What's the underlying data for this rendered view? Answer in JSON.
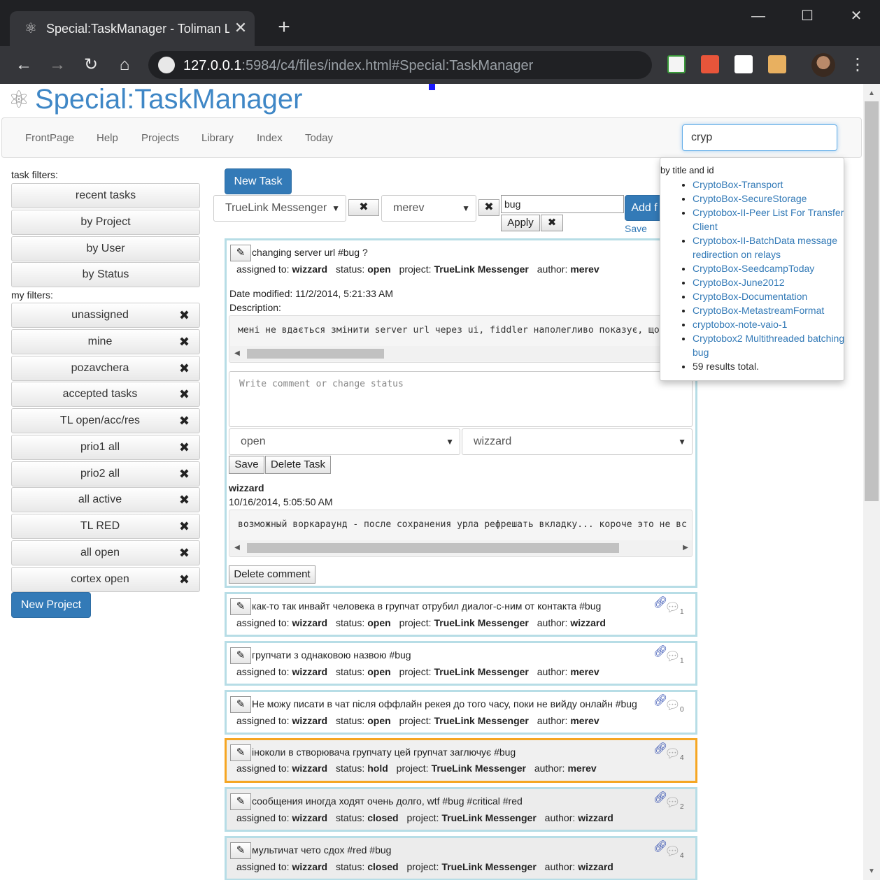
{
  "browser": {
    "tab_title": "Special:TaskManager - Toliman LL",
    "url_host": "127.0.0.1",
    "url_rest": ":5984/c4/files/index.html#Special:TaskManager",
    "tab_close": "✕",
    "new_tab": "+",
    "minimize": "—",
    "maximize": "☐",
    "close": "✕",
    "back": "←",
    "forward": "→",
    "reload": "↻",
    "home": "⌂",
    "menu": "⋮"
  },
  "page": {
    "title": "Special:TaskManager"
  },
  "nav": {
    "items": [
      "FrontPage",
      "Help",
      "Projects",
      "Library",
      "Index",
      "Today"
    ],
    "search_value": "cryp"
  },
  "search_dropdown": {
    "heading": "by title and id",
    "results": [
      "CryptoBox-Transport",
      "CryptoBox-SecureStorage",
      "Cryptobox-II-Peer List For Transfer Client",
      "Cryptobox-II-BatchData message redirection on relays",
      "CryptoBox-SeedcampToday",
      "CryptoBox-June2012",
      "CryptoBox-Documentation",
      "CryptoBox-MetastreamFormat",
      "cryptobox-note-vaio-1",
      "Cryptobox2 Multithreaded batching bug"
    ],
    "total": "59 results total."
  },
  "sidebar": {
    "task_filters_label": "task filters:",
    "task_filters": [
      "recent tasks",
      "by Project",
      "by User",
      "by Status"
    ],
    "my_filters_label": "my filters:",
    "my_filters": [
      "unassigned",
      "mine",
      "pozavchera",
      "accepted tasks",
      "TL open/acc/res",
      "prio1 all",
      "prio2 all",
      "all active",
      "TL RED",
      "all open",
      "cortex open"
    ],
    "remove_glyph": "✖",
    "new_project": "New Project"
  },
  "toolbar": {
    "new_task": "New Task",
    "project_select": "TrueLink Messenger",
    "user_select": "merev",
    "clear_glyph": "✖",
    "filter_text": "bug",
    "apply": "Apply",
    "add_btn": "Add f",
    "save_link": "Save"
  },
  "expanded_task": {
    "title": "changing server url #bug ?",
    "assigned_label": "assigned to:",
    "assigned": "wizzard",
    "status_label": "status:",
    "status": "open",
    "project_label": "project:",
    "project": "TrueLink Messenger",
    "author_label": "author:",
    "author": "merev",
    "date_modified": "Date modified: 11/2/2014, 5:21:33 AM",
    "description_label": "Description:",
    "description": "мені не вдається змінити server url через ui, fiddler наполегливо показує, що",
    "comment_placeholder": "Write comment or change status",
    "status_select": "open",
    "assignee_select": "wizzard",
    "save": "Save",
    "delete_task": "Delete Task",
    "comment_author": "wizzard",
    "comment_date": "10/16/2014, 5:05:50 AM",
    "comment_text": "возможный воркараунд - после сохранения урла рефрешать вкладку... короче это не вс",
    "delete_comment": "Delete comment"
  },
  "tasks": [
    {
      "title": "как-то так инвайт человека в групчат отрубил диалог-с-ним от контакта #bug",
      "assigned": "wizzard",
      "status": "open",
      "project": "TrueLink Messenger",
      "author": "wizzard",
      "comments": "1"
    },
    {
      "title": "групчати з однаковою назвою #bug",
      "assigned": "wizzard",
      "status": "open",
      "project": "TrueLink Messenger",
      "author": "merev",
      "comments": "1"
    },
    {
      "title": "Не можу писати в чат після оффлайн рекея до того часу, поки не вийду онлайн #bug",
      "assigned": "wizzard",
      "status": "open",
      "project": "TrueLink Messenger",
      "author": "merev",
      "comments": "0"
    },
    {
      "title": "іноколи в створювача групчату цей групчат заглючує #bug",
      "assigned": "wizzard",
      "status": "hold",
      "project": "TrueLink Messenger",
      "author": "merev",
      "comments": "4"
    },
    {
      "title": "сообщения иногда ходят очень долго, wtf #bug #critical #red",
      "assigned": "wizzard",
      "status": "closed",
      "project": "TrueLink Messenger",
      "author": "wizzard",
      "comments": "2"
    },
    {
      "title": "мультичат чето сдох #red #bug",
      "assigned": "wizzard",
      "status": "closed",
      "project": "TrueLink Messenger",
      "author": "wizzard",
      "comments": "4"
    }
  ],
  "colors": {
    "accent": "#337ab7",
    "title_blue": "#3f87c6",
    "card_border": "#b7dde6",
    "hold_border": "#f5a623"
  }
}
